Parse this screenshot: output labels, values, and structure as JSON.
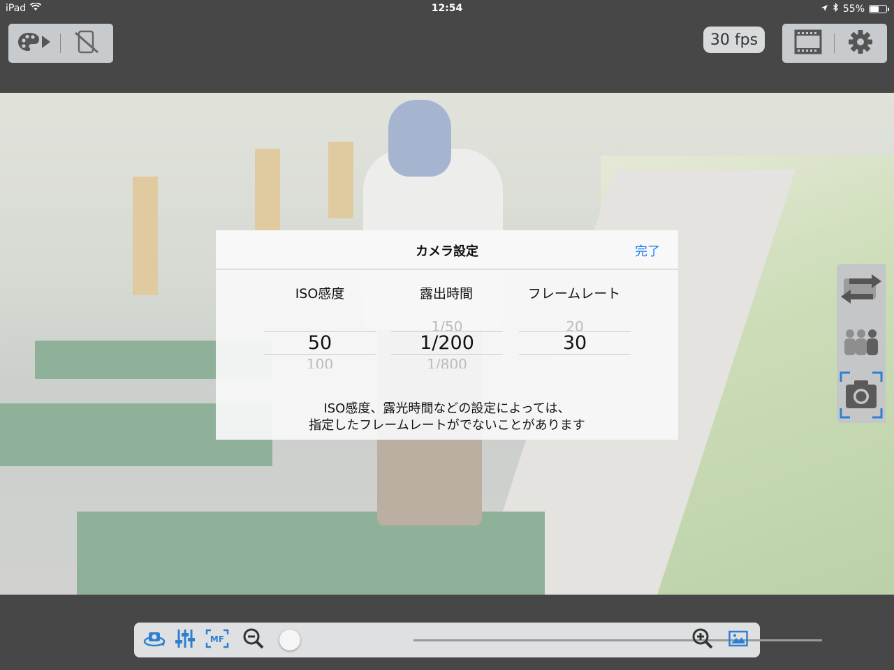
{
  "status": {
    "device": "iPad",
    "time": "12:54",
    "battery": "55%",
    "battery_fraction": 0.55
  },
  "toolbar": {
    "fps": "30 fps"
  },
  "dialog": {
    "title": "カメラ設定",
    "done": "完了",
    "columns": [
      {
        "label": "ISO感度",
        "prev": "",
        "current": "50",
        "next": "100"
      },
      {
        "label": "露出時間",
        "prev": "1/50",
        "current": "1/200",
        "next": "1/800"
      },
      {
        "label": "フレームレート",
        "prev": "20",
        "current": "30",
        "next": ""
      }
    ],
    "note_line1": "ISO感度、露光時間などの設定によっては、",
    "note_line2": "指定したフレームレートがでないことがあります"
  },
  "zoom": {
    "level_fraction": 0.0
  },
  "colors": {
    "accent": "#1a7bf5",
    "icon_blue": "#2f7fd1",
    "toolbar_gray": "#c8cbcd",
    "background": "#474747"
  },
  "icons": {
    "top_left": [
      "palette-play-icon",
      "no-device-icon"
    ],
    "top_right": [
      "film-strip-icon",
      "gear-icon"
    ],
    "side": [
      "switch-camera-icon",
      "multi-person-icon",
      "camera-capture-icon"
    ],
    "bottom": [
      "rotate-camera-icon",
      "sliders-icon",
      "manual-focus-icon",
      "zoom-out-icon",
      "zoom-in-icon",
      "photo-library-icon"
    ]
  }
}
